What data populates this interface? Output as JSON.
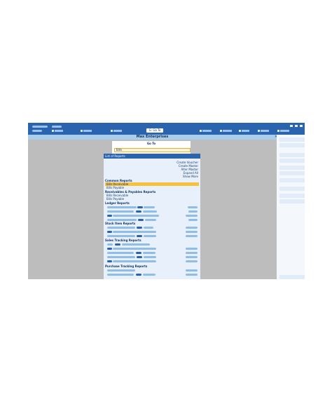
{
  "window": {
    "title": "Max Enterprises"
  },
  "toolbar": {
    "goto_label": "G: Go To",
    "goto_icon": "goto-icon"
  },
  "goto": {
    "title": "Go To",
    "search_value": "Bills"
  },
  "list": {
    "header": "List of Reports",
    "actions": [
      "Create Voucher",
      "Create Master",
      "Alter Master",
      "Expand All",
      "Show More"
    ],
    "sections": {
      "common": {
        "title": "Common Reports",
        "items": [
          {
            "label": "Bills Receivable",
            "selected": true
          },
          {
            "label": "Bills Payable",
            "selected": false
          }
        ]
      },
      "receivables_payables": {
        "title": "Receivables & Payables Reports",
        "items": [
          {
            "label": "Bills Receivable"
          },
          {
            "label": "Bills Payable"
          }
        ]
      },
      "ledger": {
        "title": "Ledger Reports"
      },
      "stock_item": {
        "title": "Stock Item Reports"
      },
      "sales_tracking": {
        "title": "Sales Tracking Reports"
      },
      "purchase_tracking": {
        "title": "Purchase Tracking Reports"
      }
    }
  },
  "colors": {
    "accent": "#2a63ae",
    "title_bar": "#a9cdea",
    "selection": "#f6c23e",
    "list_background": "#e7f0fb",
    "backdrop": "#bdbdbd"
  }
}
